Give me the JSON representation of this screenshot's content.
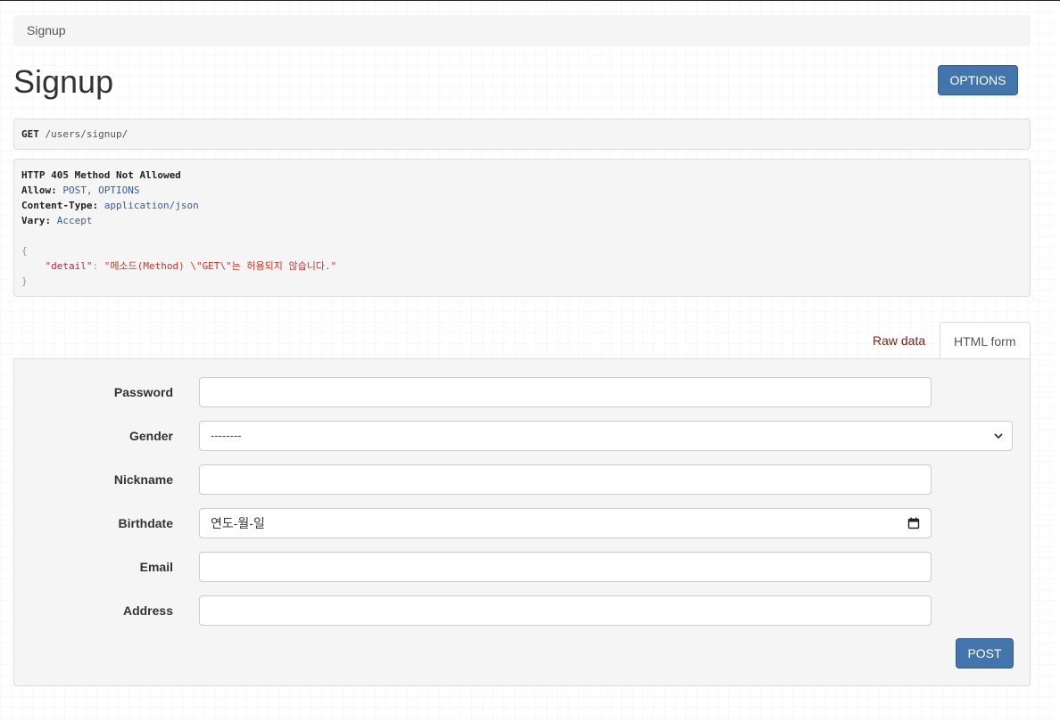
{
  "breadcrumb": {
    "label": "Signup"
  },
  "page": {
    "title": "Signup",
    "options_label": "OPTIONS"
  },
  "request": {
    "method": "GET",
    "path": "/users/signup/"
  },
  "response": {
    "status_line": "HTTP 405 Method Not Allowed",
    "headers": [
      {
        "key": "Allow",
        "value": "POST, OPTIONS"
      },
      {
        "key": "Content-Type",
        "value": "application/json"
      },
      {
        "key": "Vary",
        "value": "Accept"
      }
    ],
    "body_open": "{",
    "body_key": "\"detail\"",
    "body_value": "\"메소드(Method) \\\"GET\\\"는 허용되지 않습니다.\"",
    "body_close": "}"
  },
  "tabs": {
    "raw": "Raw data",
    "html": "HTML form"
  },
  "form": {
    "password_label": "Password",
    "gender_label": "Gender",
    "gender_value": "--------",
    "nickname_label": "Nickname",
    "birthdate_label": "Birthdate",
    "birthdate_placeholder": "연도-월-일",
    "email_label": "Email",
    "address_label": "Address",
    "submit_label": "POST"
  },
  "colors": {
    "primary": "#4175ab",
    "raw_tab": "#7a1f14",
    "panel_bg": "#f5f5f5"
  }
}
